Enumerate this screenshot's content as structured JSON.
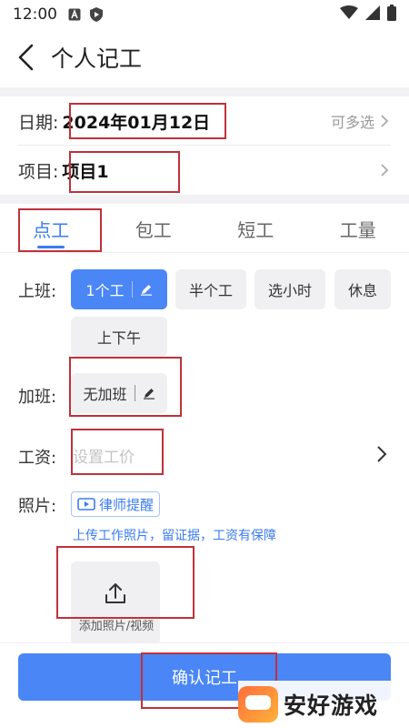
{
  "status_bar": {
    "time": "12:00"
  },
  "header": {
    "title": "个人记工"
  },
  "date_row": {
    "label": "日期:",
    "value": "2024年01月12日",
    "action": "可多选"
  },
  "project_row": {
    "label": "项目:",
    "value": "项目1"
  },
  "tabs": [
    {
      "label": "点工",
      "active": true
    },
    {
      "label": "包工",
      "active": false
    },
    {
      "label": "短工",
      "active": false
    },
    {
      "label": "工量",
      "active": false
    }
  ],
  "shift": {
    "label": "上班:",
    "options": [
      {
        "label": "1个工",
        "selected": true
      },
      {
        "label": "半个工",
        "selected": false
      },
      {
        "label": "选小时",
        "selected": false
      },
      {
        "label": "休息",
        "selected": false
      },
      {
        "label": "上下午",
        "selected": false
      }
    ]
  },
  "overtime": {
    "label": "加班:",
    "value": "无加班"
  },
  "wage": {
    "label": "工资:",
    "placeholder": "设置工价"
  },
  "photo": {
    "label": "照片:",
    "lawyer_tag": "律师提醒",
    "tip": "上传工作照片，留证据，工资有保障",
    "upload_label": "添加照片/视频"
  },
  "footer": {
    "confirm_label": "确认记工"
  },
  "watermark": {
    "text": "安好游戏"
  },
  "colors": {
    "accent": "#4a86f5",
    "highlight_box": "#c0313a"
  }
}
